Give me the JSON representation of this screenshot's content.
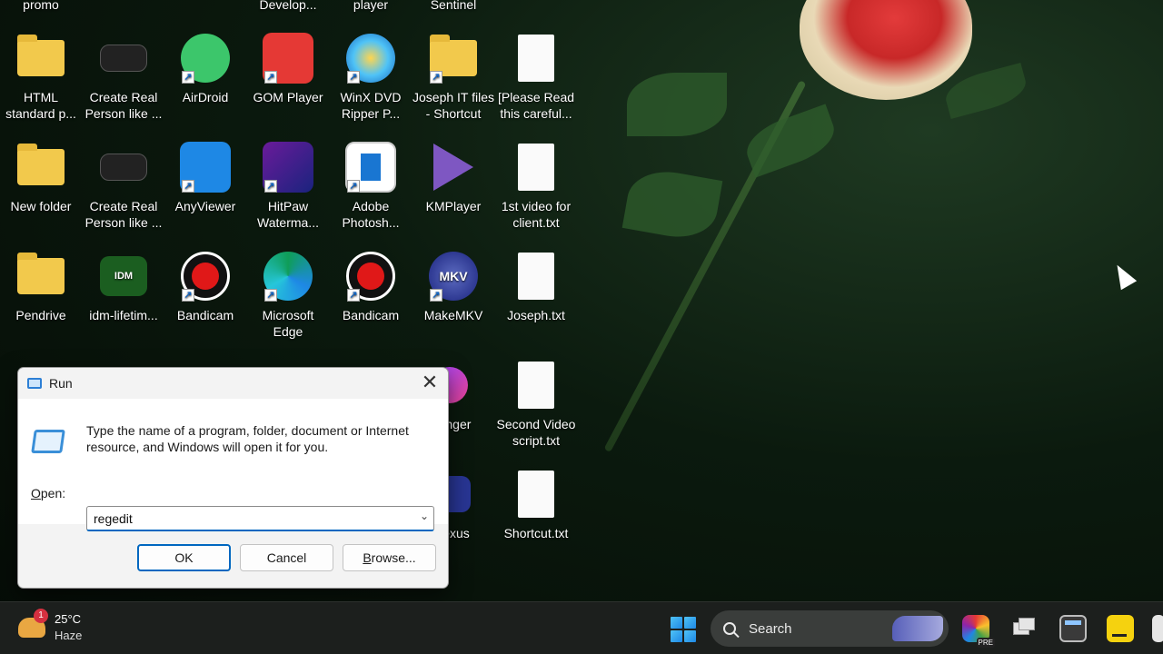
{
  "desktop": {
    "icons": [
      {
        "label": "promo",
        "type": "text"
      },
      {
        "label": "Develop...",
        "type": "text"
      },
      {
        "label": "player",
        "type": "text"
      },
      {
        "label": "Sentinel",
        "type": "text"
      },
      {
        "label": "HTML\nstandard p...",
        "type": "folder"
      },
      {
        "label": "Create Real\nPerson like ...",
        "type": "video"
      },
      {
        "label": "AirDroid",
        "type": "app"
      },
      {
        "label": "GOM Player",
        "type": "app"
      },
      {
        "label": "WinX DVD\nRipper P...",
        "type": "app"
      },
      {
        "label": "Joseph IT files\n- Shortcut",
        "type": "folder"
      },
      {
        "label": "[Please Read\nthis careful...",
        "type": "doc"
      },
      {
        "label": "New folder",
        "type": "folder"
      },
      {
        "label": "Create Real\nPerson like ...",
        "type": "video"
      },
      {
        "label": "AnyViewer",
        "type": "app"
      },
      {
        "label": "HitPaw\nWaterma...",
        "type": "app"
      },
      {
        "label": "Adobe\nPhotosh...",
        "type": "app"
      },
      {
        "label": "KMPlayer",
        "type": "app"
      },
      {
        "label": "1st video for\nclient.txt",
        "type": "doc"
      },
      {
        "label": "Pendrive",
        "type": "folder"
      },
      {
        "label": "idm-lifetim...",
        "type": "app"
      },
      {
        "label": "Bandicam",
        "type": "app"
      },
      {
        "label": "Microsoft\nEdge",
        "type": "app"
      },
      {
        "label": "Bandicam",
        "type": "app"
      },
      {
        "label": "MakeMKV",
        "type": "app"
      },
      {
        "label": "Joseph.txt",
        "type": "doc"
      },
      {
        "label": "senger",
        "type": "app"
      },
      {
        "label": "Second Video\nscript.txt",
        "type": "doc"
      },
      {
        "label": "exus",
        "type": "app"
      },
      {
        "label": "Shortcut.txt",
        "type": "doc"
      }
    ],
    "idm_badge": "IDM",
    "mkv_badge": "MKV"
  },
  "run_dialog": {
    "title": "Run",
    "close": "✕",
    "description": "Type the name of a program, folder, document or Internet resource, and Windows will open it for you.",
    "open_label_prefix": "",
    "open_label_underlined": "O",
    "open_label_rest": "pen:",
    "open_value": "regedit",
    "ok_label": "OK",
    "cancel_label": "Cancel",
    "browse_label_underlined": "B",
    "browse_label_rest": "rowse..."
  },
  "taskbar": {
    "weather_temp": "25°C",
    "weather_condition": "Haze",
    "weather_badge": "1",
    "search_label": "Search",
    "copilot_badge": "PRE"
  }
}
